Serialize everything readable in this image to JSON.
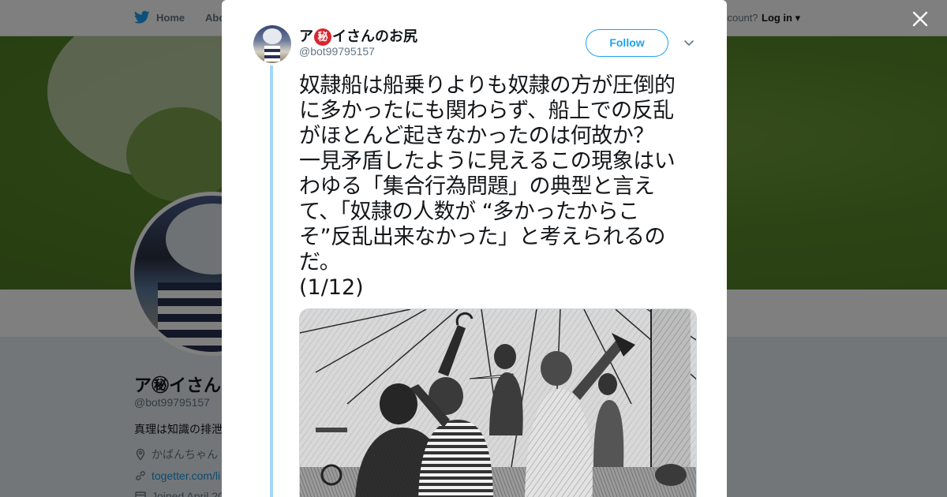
{
  "topnav": {
    "home_label": "Home",
    "about_label": "Abo",
    "account_prompt": "ccount?",
    "login_label": "Log in"
  },
  "profile": {
    "name": "ア㊙イさん",
    "handle": "@bot99795157",
    "bio": "真理は知識の排泄",
    "location": "かばんちゃん",
    "link": "togetter.com/li",
    "joined": "Joined April 20"
  },
  "modal": {
    "author": {
      "name_before": "ア",
      "name_secret": "秘",
      "name_after": "イさんのお尻",
      "handle": "@bot99795157"
    },
    "follow_label": "Follow",
    "tweet": {
      "lines": [
        "奴隷船は船乗りよりも奴隷の方が圧倒的",
        "に多かったにも関わらず、船上での反乱",
        "がほとんど起きなかったのは何故か？",
        "一見矛盾したように見えるこの現象はい",
        "わゆる「集合行為問題」の典型と言え",
        "て、「奴隷の人数が “多かったからこ",
        "そ”反乱出来なかった」と考えられるの",
        "だ。"
      ],
      "count": "(1/12)"
    },
    "media": {
      "kind": "engraving",
      "alt_name": "slave-ship-revolt-engraving"
    }
  },
  "colors": {
    "twitter_blue": "#1da1f2",
    "thread_line": "#a6d6f7",
    "secret_red": "#d9262e"
  },
  "icons": [
    "twitter-bird-icon",
    "close-icon",
    "chevron-down-icon",
    "location-pin-icon",
    "link-icon",
    "calendar-icon"
  ]
}
